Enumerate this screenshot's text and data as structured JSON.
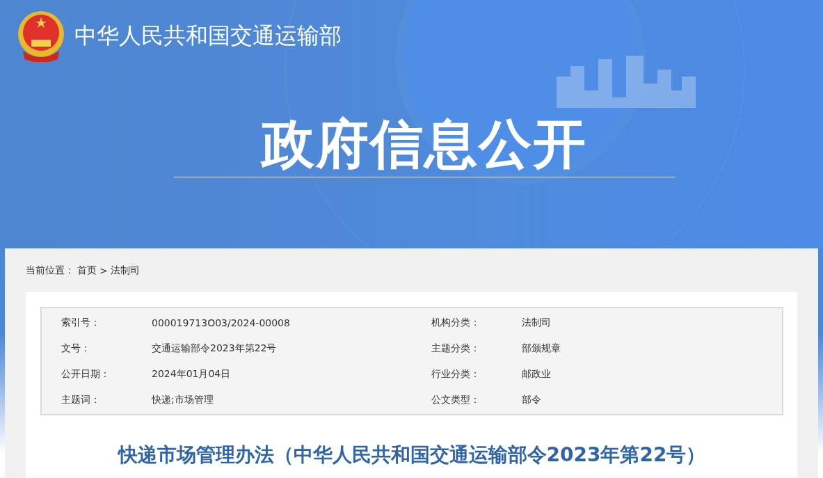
{
  "header": {
    "site_name": "中华人民共和国交通运输部",
    "banner_title": "政府信息公开"
  },
  "breadcrumb": {
    "label": "当前位置：",
    "items": [
      "首页",
      "法制司"
    ],
    "separator": ">"
  },
  "info": [
    {
      "label": "索引号：",
      "value": "000019713O03/2024-00008"
    },
    {
      "label": "机构分类：",
      "value": "法制司"
    },
    {
      "label": "文号：",
      "value": "交通运输部令2023年第22号"
    },
    {
      "label": "主题分类：",
      "value": "部颁规章"
    },
    {
      "label": "公开日期：",
      "value": "2024年01月04日"
    },
    {
      "label": "行业分类：",
      "value": "邮政业"
    },
    {
      "label": "主题词：",
      "value": "快递;市场管理"
    },
    {
      "label": "公文类型：",
      "value": "部令"
    }
  ],
  "article_title": "快递市场管理办法（中华人民共和国交通运输部令2023年第22号）"
}
